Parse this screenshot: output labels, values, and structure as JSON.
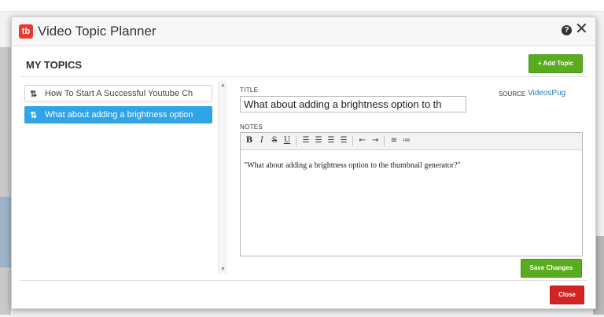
{
  "modal": {
    "logo_text": "tb",
    "title": "Video Topic Planner",
    "help_symbol": "?",
    "close_symbol": "✕"
  },
  "section": {
    "title": "MY TOPICS",
    "add_button": "+ Add Topic"
  },
  "topics": [
    {
      "label": "How To Start A Successful Youtube Ch",
      "selected": false
    },
    {
      "label": "What about adding a brightness option",
      "selected": true
    }
  ],
  "form": {
    "title_label": "TITLE",
    "title_value": "What about adding a brightness option to th",
    "source_label": "SOURCE",
    "source_value": "VideosPug",
    "notes_label": "NOTES",
    "notes_text": "\"What about adding a brightness option to the thumbnail generator?\""
  },
  "toolbar": [
    "bold-icon",
    "italic-icon",
    "strikethrough-icon",
    "underline-icon",
    "align-left-icon",
    "align-center-icon",
    "align-right-icon",
    "align-justify-icon",
    "outdent-icon",
    "indent-icon",
    "ordered-list-icon",
    "unordered-list-icon"
  ],
  "buttons": {
    "save": "Save Changes",
    "close": "Close"
  },
  "colors": {
    "accent_blue": "#2fa4e7",
    "green": "#5aac1f",
    "red": "#d42323"
  }
}
